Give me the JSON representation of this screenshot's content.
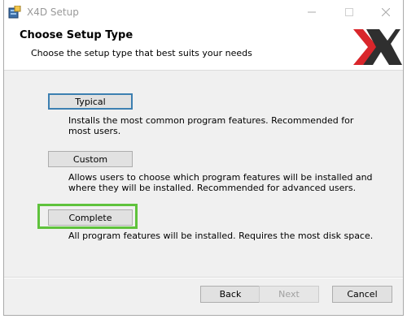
{
  "window": {
    "title": "X4D Setup"
  },
  "header": {
    "title": "Choose Setup Type",
    "subtitle": "Choose the setup type that best suits your needs"
  },
  "options": [
    {
      "label": "Typical",
      "description": "Installs the most common program features. Recommended for most users."
    },
    {
      "label": "Custom",
      "description": "Allows users to choose which program features will be installed and where they will be installed. Recommended for advanced users."
    },
    {
      "label": "Complete",
      "description": "All program features will be installed. Requires the most disk space."
    }
  ],
  "footer": {
    "back_label": "Back",
    "next_label": "Next",
    "cancel_label": "Cancel"
  },
  "colors": {
    "highlight": "#5fc23c",
    "default_button_border": "#3c7fb1",
    "logo_red": "#d9262b",
    "logo_dark": "#2f2f2f"
  },
  "icons": {
    "app": "installer-icon",
    "logo": "x-logo"
  }
}
